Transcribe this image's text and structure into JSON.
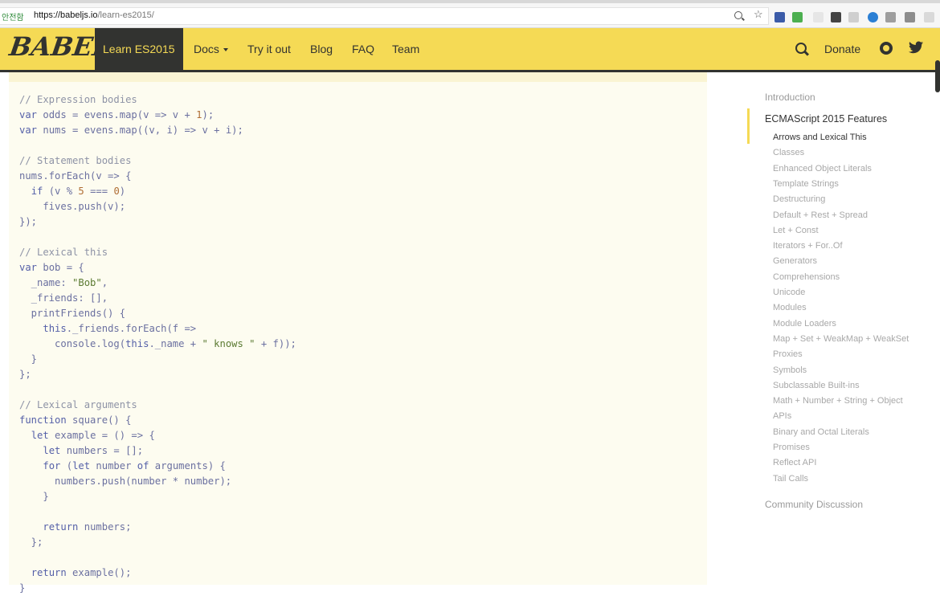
{
  "browser": {
    "secure_label": "안전함",
    "url_host": "https://babeljs.io",
    "url_path": "/learn-es2015/",
    "icons": [
      "zoom-icon",
      "bookmark-star-icon",
      "extension-icons"
    ]
  },
  "navbar": {
    "logo": "BABEL",
    "items": [
      {
        "label": "Learn ES2015",
        "active": true
      },
      {
        "label": "Docs",
        "has_caret": true
      },
      {
        "label": "Try it out"
      },
      {
        "label": "Blog"
      },
      {
        "label": "FAQ"
      },
      {
        "label": "Team"
      }
    ],
    "donate": "Donate",
    "colors": {
      "bar": "#f5da55",
      "dark": "#323330"
    }
  },
  "code": {
    "lines": [
      "// Expression bodies",
      "var odds = evens.map(v => v + 1);",
      "var nums = evens.map((v, i) => v + i);",
      "",
      "// Statement bodies",
      "nums.forEach(v => {",
      "  if (v % 5 === 0)",
      "    fives.push(v);",
      "});",
      "",
      "// Lexical this",
      "var bob = {",
      "  _name: \"Bob\",",
      "  _friends: [],",
      "  printFriends() {",
      "    this._friends.forEach(f =>",
      "      console.log(this._name + \" knows \" + f));",
      "  }",
      "};",
      "",
      "// Lexical arguments",
      "function square() {",
      "  let example = () => {",
      "    let numbers = [];",
      "    for (let number of arguments) {",
      "      numbers.push(number * number);",
      "    }",
      "",
      "    return numbers;",
      "  };",
      "",
      "  return example();",
      "}"
    ]
  },
  "sidebar": {
    "introduction": "Introduction",
    "section_title": "ECMAScript 2015 Features",
    "items": [
      "Arrows and Lexical This",
      "Classes",
      "Enhanced Object Literals",
      "Template Strings",
      "Destructuring",
      "Default + Rest + Spread",
      "Let + Const",
      "Iterators + For..Of",
      "Generators",
      "Comprehensions",
      "Unicode",
      "Modules",
      "Module Loaders",
      "Map + Set + WeakMap + WeakSet",
      "Proxies",
      "Symbols",
      "Subclassable Built-ins",
      "Math + Number + String + Object",
      "APIs",
      "Binary and Octal Literals",
      "Promises",
      "Reflect API",
      "Tail Calls"
    ],
    "active_item": "Arrows and Lexical This",
    "community": "Community Discussion"
  }
}
